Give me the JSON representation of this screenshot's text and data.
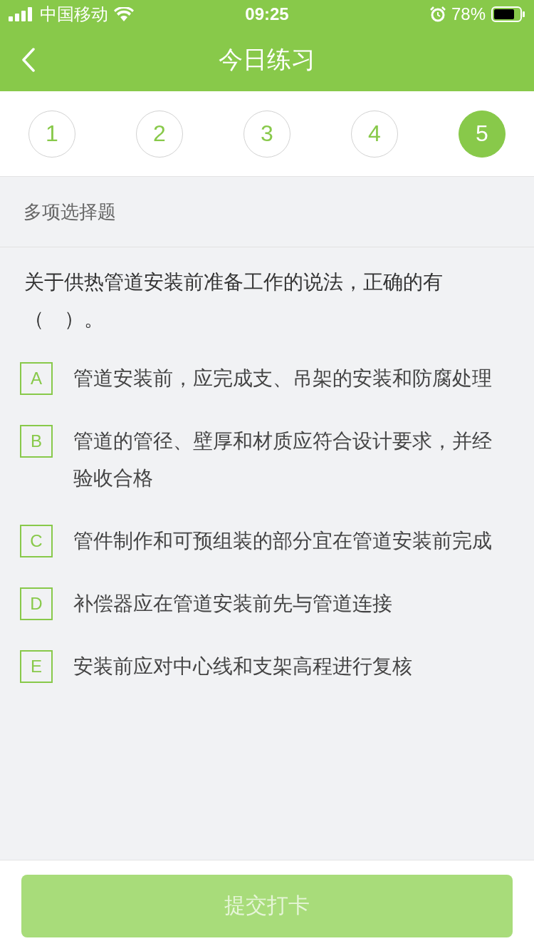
{
  "status_bar": {
    "carrier": "中国移动",
    "time": "09:25",
    "battery": "78%"
  },
  "nav": {
    "title": "今日练习"
  },
  "steps": [
    {
      "label": "1",
      "selected": false
    },
    {
      "label": "2",
      "selected": false
    },
    {
      "label": "3",
      "selected": false
    },
    {
      "label": "4",
      "selected": false
    },
    {
      "label": "5",
      "selected": true
    }
  ],
  "section": "多项选择题",
  "question": "关于供热管道安装前准备工作的说法，正确的有（　）。",
  "options": [
    {
      "letter": "A",
      "text": "管道安装前，应完成支、吊架的安装和防腐处理",
      "selected": false
    },
    {
      "letter": "B",
      "text": "管道的管径、壁厚和材质应符合设计要求，并经验收合格",
      "selected": false
    },
    {
      "letter": "C",
      "text": "管件制作和可预组装的部分宜在管道安装前完成",
      "selected": false
    },
    {
      "letter": "D",
      "text": "补偿器应在管道安装前先与管道连接",
      "selected": false
    },
    {
      "letter": "E",
      "text": "安装前应对中心线和支架高程进行复核",
      "selected": false
    }
  ],
  "submit": {
    "label": "提交打卡",
    "disabled": true
  }
}
